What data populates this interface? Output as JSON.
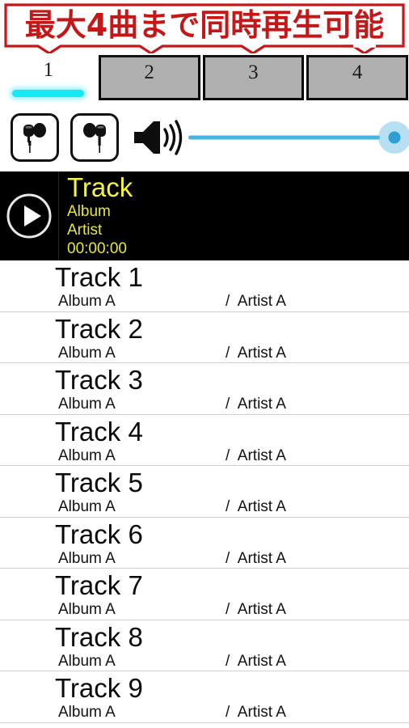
{
  "annotation": {
    "text": "最大4曲まで同時再生可能",
    "color": "#c41818",
    "arrow_count": 4
  },
  "tabs": {
    "active_index": 0,
    "items": [
      {
        "label": "1",
        "state": "active"
      },
      {
        "label": "2",
        "state": "inactive"
      },
      {
        "label": "3",
        "state": "inactive"
      },
      {
        "label": "4",
        "state": "inactive"
      }
    ],
    "active_indicator_color": "#16e8f5",
    "inactive_background": "#b0b0b0"
  },
  "output_bar": {
    "buttons": [
      {
        "icon": "earphone-icon",
        "name": "earphone-left-button"
      },
      {
        "icon": "earphone-icon",
        "name": "earphone-right-button"
      }
    ],
    "speaker_icon": "speaker-volume-icon",
    "volume": {
      "value": 100,
      "min": 0,
      "max": 100,
      "track_color": "#46b6e0",
      "thumb_color": "#2e9ed4"
    }
  },
  "now_playing": {
    "play_icon": "play-circle-icon",
    "title": "Track",
    "album": "Album",
    "artist": "Artist",
    "time": "00:00:00",
    "text_color": "#f4f244",
    "background": "#000000"
  },
  "track_list": {
    "separator": "/",
    "rows": [
      {
        "title": "Track 1",
        "album": "Album A",
        "artist": "Artist A"
      },
      {
        "title": "Track 2",
        "album": "Album A",
        "artist": "Artist A"
      },
      {
        "title": "Track 3",
        "album": "Album A",
        "artist": "Artist A"
      },
      {
        "title": "Track 4",
        "album": "Album A",
        "artist": "Artist A"
      },
      {
        "title": "Track 5",
        "album": "Album A",
        "artist": "Artist A"
      },
      {
        "title": "Track 6",
        "album": "Album A",
        "artist": "Artist A"
      },
      {
        "title": "Track 7",
        "album": "Album A",
        "artist": "Artist A"
      },
      {
        "title": "Track 8",
        "album": "Album A",
        "artist": "Artist A"
      },
      {
        "title": "Track 9",
        "album": "Album A",
        "artist": "Artist A"
      }
    ]
  }
}
